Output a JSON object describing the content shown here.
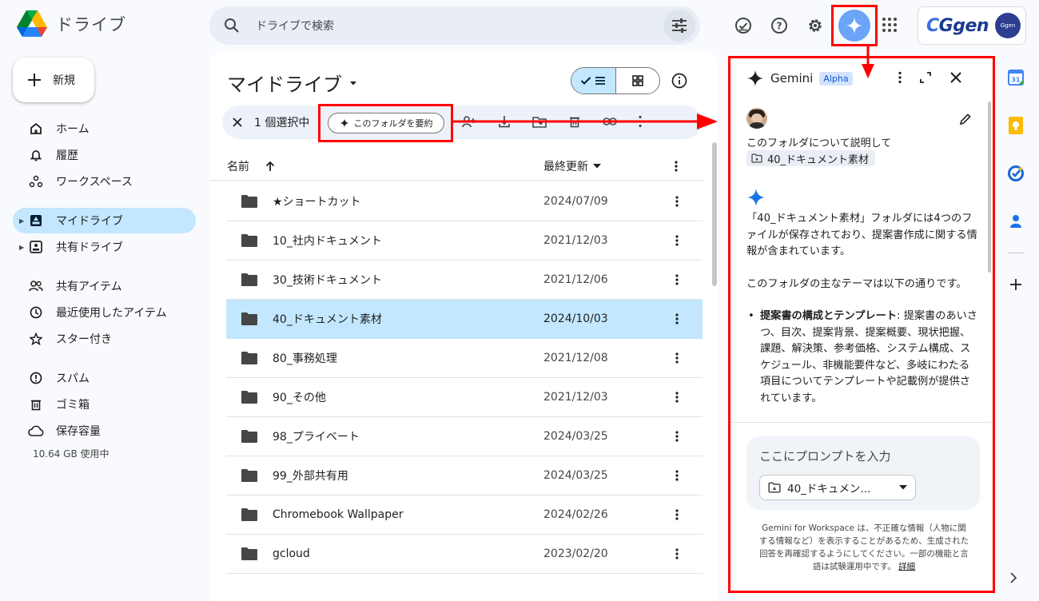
{
  "header": {
    "app_name": "ドライブ",
    "search_placeholder": "ドライブで検索",
    "account_brand": "Ggen",
    "account_avatar_text": "Ggen"
  },
  "colors": {
    "accent_selected": "#c2e7ff",
    "annotation_red": "#ff0000",
    "gemini_blue": "#6ba4f8",
    "panel_bg": "#f8fafd"
  },
  "sidebar": {
    "new_label": "新規",
    "items": [
      {
        "label": "ホーム",
        "icon": "home-icon"
      },
      {
        "label": "履歴",
        "icon": "bell-icon"
      },
      {
        "label": "ワークスペース",
        "icon": "workspace-icon"
      },
      {
        "label": "マイドライブ",
        "icon": "my-drive-icon"
      },
      {
        "label": "共有ドライブ",
        "icon": "shared-drive-icon"
      },
      {
        "label": "共有アイテム",
        "icon": "people-icon"
      },
      {
        "label": "最近使用したアイテム",
        "icon": "clock-icon"
      },
      {
        "label": "スター付き",
        "icon": "star-icon"
      },
      {
        "label": "スパム",
        "icon": "spam-icon"
      },
      {
        "label": "ゴミ箱",
        "icon": "trash-icon"
      },
      {
        "label": "保存容量",
        "icon": "cloud-icon"
      }
    ],
    "storage_text": "10.64 GB 使用中"
  },
  "main": {
    "title": "マイドライブ",
    "selection_count": "1 個選択中",
    "summarize_label": "このフォルダを要約",
    "columns": {
      "name": "名前",
      "modified": "最終更新"
    },
    "files": [
      {
        "name": "★ショートカット",
        "modified": "2024/07/09"
      },
      {
        "name": "10_社内ドキュメント",
        "modified": "2021/12/03"
      },
      {
        "name": "30_技術ドキュメント",
        "modified": "2021/12/06"
      },
      {
        "name": "40_ドキュメント素材",
        "modified": "2024/10/03"
      },
      {
        "name": "80_事務処理",
        "modified": "2021/12/08"
      },
      {
        "name": "90_その他",
        "modified": "2021/12/03"
      },
      {
        "name": "98_プライベート",
        "modified": "2024/03/25"
      },
      {
        "name": "99_外部共有用",
        "modified": "2024/03/25"
      },
      {
        "name": "Chromebook Wallpaper",
        "modified": "2024/02/26"
      },
      {
        "name": "gcloud",
        "modified": "2023/02/20"
      }
    ]
  },
  "gemini": {
    "title": "Gemini",
    "badge": "Alpha",
    "user_prompt": "このフォルダについて説明して",
    "folder_chip": "40_ドキュメント素材",
    "answer_p1": "「40_ドキュメント素材」フォルダには4つのファイルが保存されており、提案書作成に関する情報が含まれています。",
    "answer_p2": "このフォルダの主なテーマは以下の通りです。",
    "bullet_title": "提案書の構成とテンプレート",
    "bullet_body": ": 提案書のあいさつ、目次、提案背景、提案概要、現状把握、課題、解決策、参考価格、システム構成、スケジュール、非機能要件など、多岐にわたる項目についてテンプレートや記載例が提供されています。",
    "input_placeholder": "ここにプロンプトを入力",
    "folder_select": "40_ドキュメン...",
    "disclaimer": "Gemini for Workspace は、不正確な情報（人物に関する情報など）を表示することがあるため、生成された回答を再確認するようにしてください。一部の機能と言語は試験運用中です。",
    "disclaimer_link": "詳細"
  }
}
